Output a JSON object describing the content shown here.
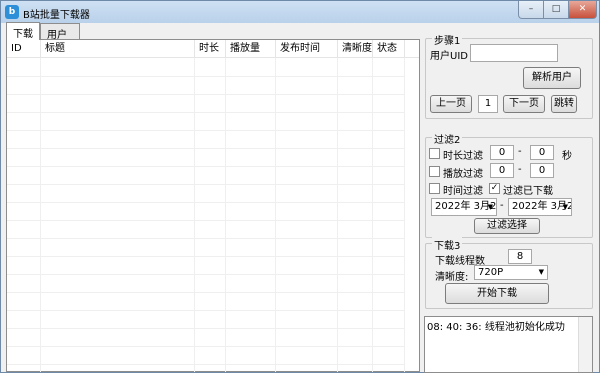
{
  "window": {
    "title": "B站批量下载器",
    "icon": "bilibili-icon"
  },
  "window_buttons": {
    "minimize": "–",
    "maximize": "□",
    "close": "✕"
  },
  "tabs": [
    {
      "label": "下载",
      "active": true
    },
    {
      "label": "用户",
      "active": false
    }
  ],
  "table": {
    "columns": [
      "ID",
      "标题",
      "时长",
      "播放量",
      "发布时间",
      "清晰度",
      "状态"
    ],
    "rows": []
  },
  "step1": {
    "legend": "步骤1",
    "uid_label": "用户UID",
    "uid_value": "",
    "parse_button": "解析用户",
    "prev_button": "上一页",
    "page_value": "1",
    "next_button": "下一页",
    "jump_button": "跳转"
  },
  "filter": {
    "legend": "过滤2",
    "duration": {
      "label": "时长过滤",
      "checked": false,
      "min": "0",
      "sep": "-",
      "max": "0",
      "unit": "秒"
    },
    "plays": {
      "label": "播放过滤",
      "checked": false,
      "min": "0",
      "sep": "-",
      "max": "0"
    },
    "time": {
      "label": "时间过滤",
      "checked": false
    },
    "downloaded": {
      "label": "过滤已下载",
      "checked": true,
      "mark": "✓"
    },
    "date_from": "2022年 3月2",
    "date_sep": "-",
    "date_to": "2022年 3月2",
    "apply_button": "过滤选择"
  },
  "download": {
    "legend": "下载3",
    "threads_label": "下载线程数",
    "threads_value": "8",
    "quality_label": "清晰度:",
    "quality_value": "720P",
    "start_button": "开始下载"
  },
  "log": {
    "lines": [
      "08: 40: 36: 线程池初始化成功"
    ]
  }
}
